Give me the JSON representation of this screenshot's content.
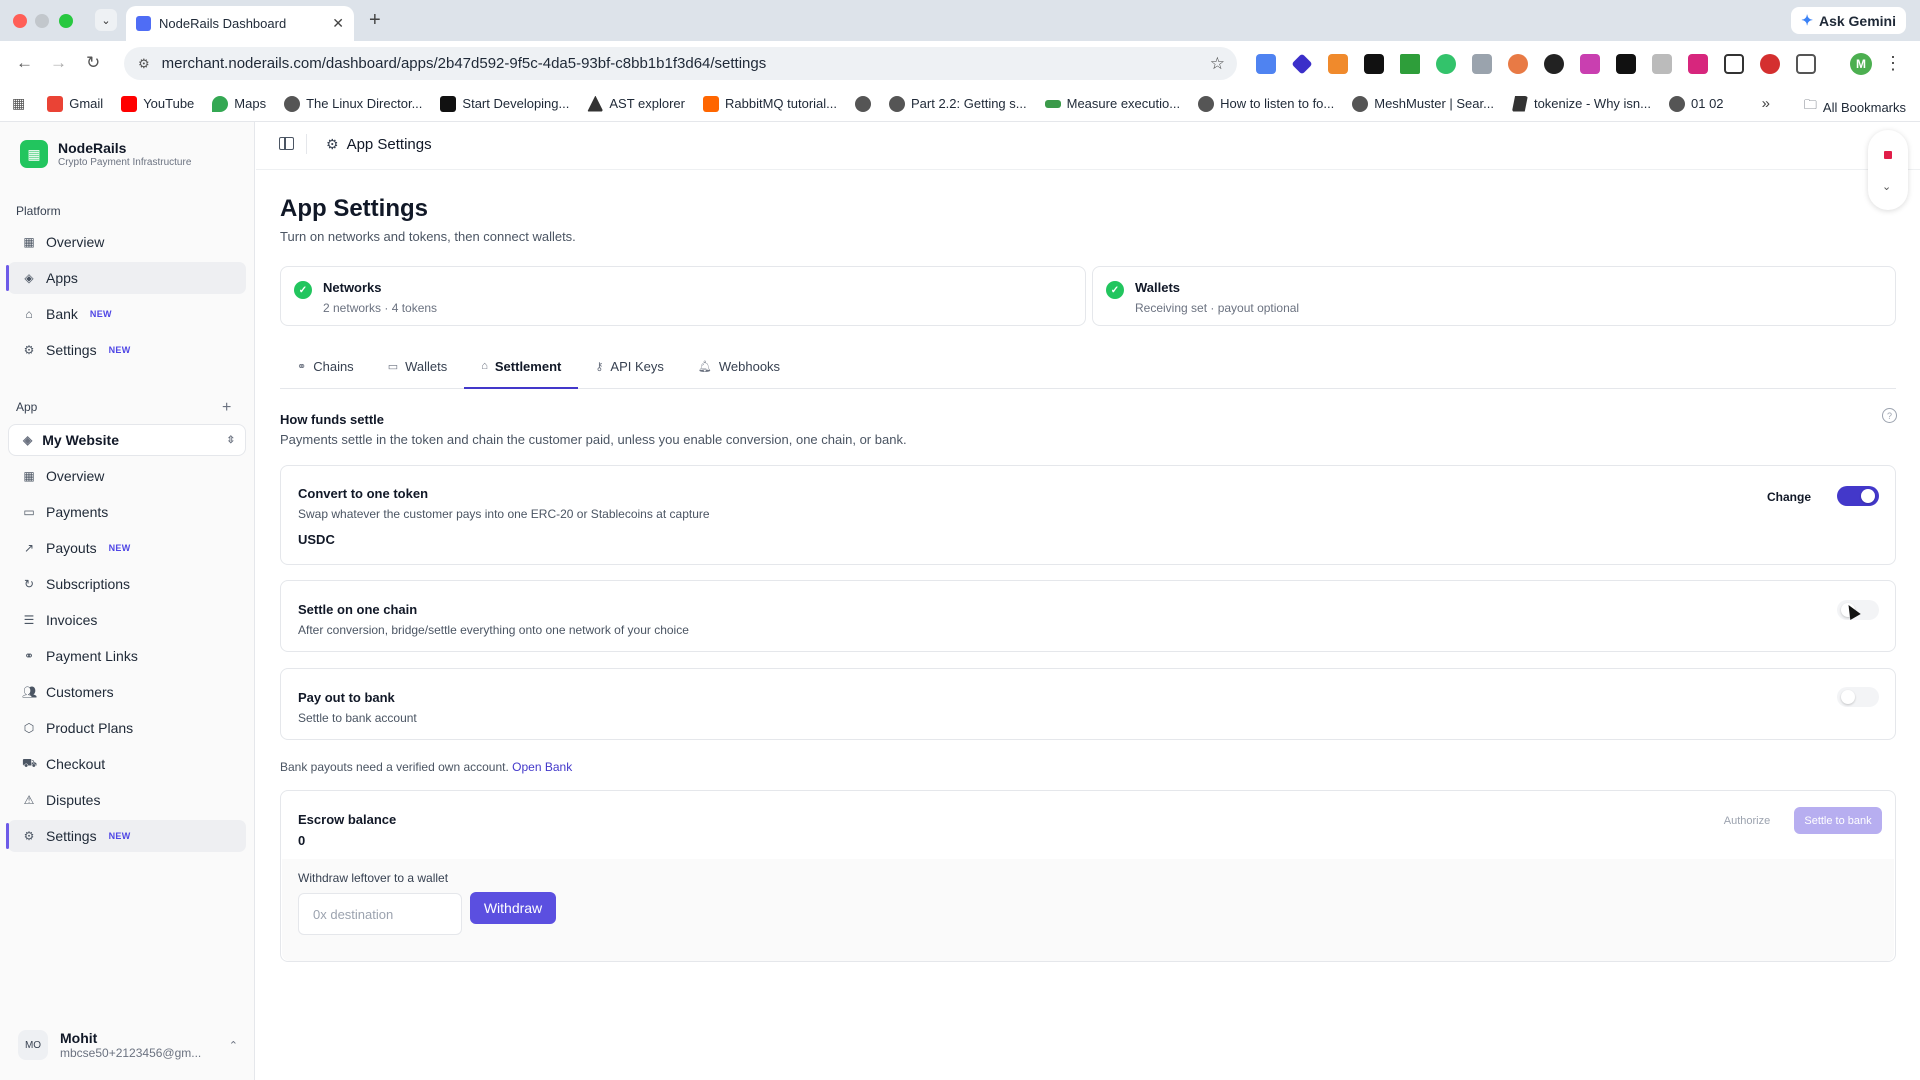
{
  "browser": {
    "tab_title": "NodeRails Dashboard",
    "url": "merchant.noderails.com/dashboard/apps/2b47d592-9f5c-4da5-93bf-c8bb1b1f3d64/settings",
    "gemini_label": "Ask Gemini",
    "profile_initial": "M",
    "bookmarks": [
      "Gmail",
      "YouTube",
      "Maps",
      "The Linux Director...",
      "Start Developing...",
      "AST explorer",
      "RabbitMQ tutorial...",
      "",
      "Part 2.2: Getting s...",
      "Measure executio...",
      "How to listen to fo...",
      "MeshMuster | Sear...",
      "tokenize - Why isn...",
      "01 02"
    ],
    "all_bookmarks": "All Bookmarks"
  },
  "sidebar": {
    "brand_name": "NodeRails",
    "brand_sub": "Crypto Payment Infrastructure",
    "platform_label": "Platform",
    "platform_items": [
      {
        "label": "Overview",
        "badge": ""
      },
      {
        "label": "Apps",
        "badge": ""
      },
      {
        "label": "Bank",
        "badge": "NEW"
      },
      {
        "label": "Settings",
        "badge": "NEW"
      }
    ],
    "app_label": "App",
    "app_selected": "My Website",
    "app_items": [
      {
        "label": "Overview",
        "badge": ""
      },
      {
        "label": "Payments",
        "badge": ""
      },
      {
        "label": "Payouts",
        "badge": "NEW"
      },
      {
        "label": "Subscriptions",
        "badge": ""
      },
      {
        "label": "Invoices",
        "badge": ""
      },
      {
        "label": "Payment Links",
        "badge": ""
      },
      {
        "label": "Customers",
        "badge": ""
      },
      {
        "label": "Product Plans",
        "badge": ""
      },
      {
        "label": "Checkout",
        "badge": ""
      },
      {
        "label": "Disputes",
        "badge": ""
      },
      {
        "label": "Settings",
        "badge": "NEW"
      }
    ],
    "user": {
      "initials": "MO",
      "name": "Mohit",
      "email": "mbcse50+2123456@gm..."
    }
  },
  "main": {
    "breadcrumb": "App Settings",
    "title": "App Settings",
    "subtitle": "Turn on networks and tokens, then connect wallets.",
    "summary": {
      "networks_title": "Networks",
      "networks_sub": "2 networks · 4 tokens",
      "wallets_title": "Wallets",
      "wallets_sub": "Receiving set · payout optional"
    },
    "tabs": [
      "Chains",
      "Wallets",
      "Settlement",
      "API Keys",
      "Webhooks"
    ],
    "active_tab": "Settlement",
    "how": {
      "title": "How funds settle",
      "subtitle": "Payments settle in the token and chain the customer paid, unless you enable conversion, one chain, or bank."
    },
    "options": {
      "convert": {
        "title": "Convert to one token",
        "subtitle": "Swap whatever the customer pays into one ERC-20 or Stablecoins at capture",
        "value": "USDC",
        "change_label": "Change",
        "enabled": true
      },
      "chain": {
        "title": "Settle on one chain",
        "subtitle": "After conversion, bridge/settle everything onto one network of your choice",
        "enabled": false
      },
      "bank": {
        "title": "Pay out to bank",
        "subtitle": "Settle to bank account",
        "enabled": false
      }
    },
    "bank_note": "Bank payouts need a verified own account.",
    "bank_link": "Open Bank",
    "escrow": {
      "title": "Escrow balance",
      "value": "0",
      "authorize_label": "Authorize",
      "settle_label": "Settle to bank",
      "withdraw_label": "Withdraw leftover to a wallet",
      "destination_placeholder": "0x destination",
      "withdraw_button": "Withdraw"
    }
  },
  "colors": {
    "accent": "#4338ca",
    "success": "#22c55e",
    "badge_new": "#4f46e5"
  }
}
